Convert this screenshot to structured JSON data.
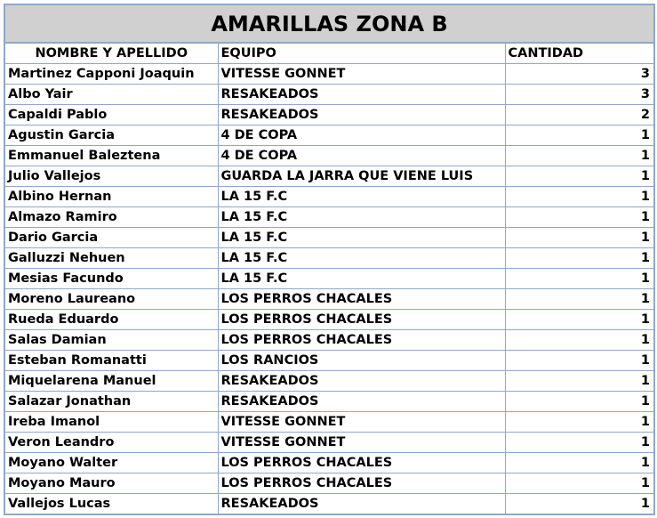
{
  "title": "AMARILLAS ZONA B",
  "headers": {
    "name": "NOMBRE Y APELLIDO",
    "team": "EQUIPO",
    "qty": "CANTIDAD"
  },
  "rows": [
    {
      "name": "Martinez Capponi Joaquin",
      "team": "VITESSE GONNET",
      "qty": "3"
    },
    {
      "name": "Albo Yair",
      "team": "RESAKEADOS",
      "qty": "3"
    },
    {
      "name": "Capaldi Pablo",
      "team": "RESAKEADOS",
      "qty": "2"
    },
    {
      "name": "Agustin Garcia",
      "team": "4 DE COPA",
      "qty": "1"
    },
    {
      "name": "Emmanuel Baleztena",
      "team": "4 DE COPA",
      "qty": "1"
    },
    {
      "name": "Julio Vallejos",
      "team": "GUARDA LA JARRA QUE VIENE LUIS",
      "qty": "1"
    },
    {
      "name": "Albino Hernan",
      "team": "LA 15 F.C",
      "qty": "1"
    },
    {
      "name": "Almazo Ramiro",
      "team": "LA 15 F.C",
      "qty": "1"
    },
    {
      "name": "Dario Garcia",
      "team": "LA 15 F.C",
      "qty": "1"
    },
    {
      "name": "Galluzzi Nehuen",
      "team": "LA 15 F.C",
      "qty": "1"
    },
    {
      "name": "Mesias Facundo",
      "team": "LA 15 F.C",
      "qty": "1"
    },
    {
      "name": "Moreno Laureano",
      "team": "LOS PERROS CHACALES",
      "qty": "1"
    },
    {
      "name": "Rueda Eduardo",
      "team": "LOS PERROS CHACALES",
      "qty": "1"
    },
    {
      "name": "Salas Damian",
      "team": "LOS PERROS CHACALES",
      "qty": "1"
    },
    {
      "name": "Esteban Romanatti",
      "team": "LOS RANCIOS",
      "qty": "1"
    },
    {
      "name": "Miquelarena Manuel",
      "team": "RESAKEADOS",
      "qty": "1"
    },
    {
      "name": "Salazar Jonathan",
      "team": "RESAKEADOS",
      "qty": "1"
    },
    {
      "name": "Ireba Imanol",
      "team": "VITESSE GONNET",
      "qty": "1"
    },
    {
      "name": "Veron Leandro",
      "team": "VITESSE GONNET",
      "qty": "1"
    },
    {
      "name": "Moyano Walter",
      "team": "LOS PERROS CHACALES",
      "qty": "1"
    },
    {
      "name": "Moyano Mauro",
      "team": "LOS PERROS CHACALES",
      "qty": "1"
    },
    {
      "name": "Vallejos Lucas",
      "team": "RESAKEADOS",
      "qty": "1"
    }
  ]
}
